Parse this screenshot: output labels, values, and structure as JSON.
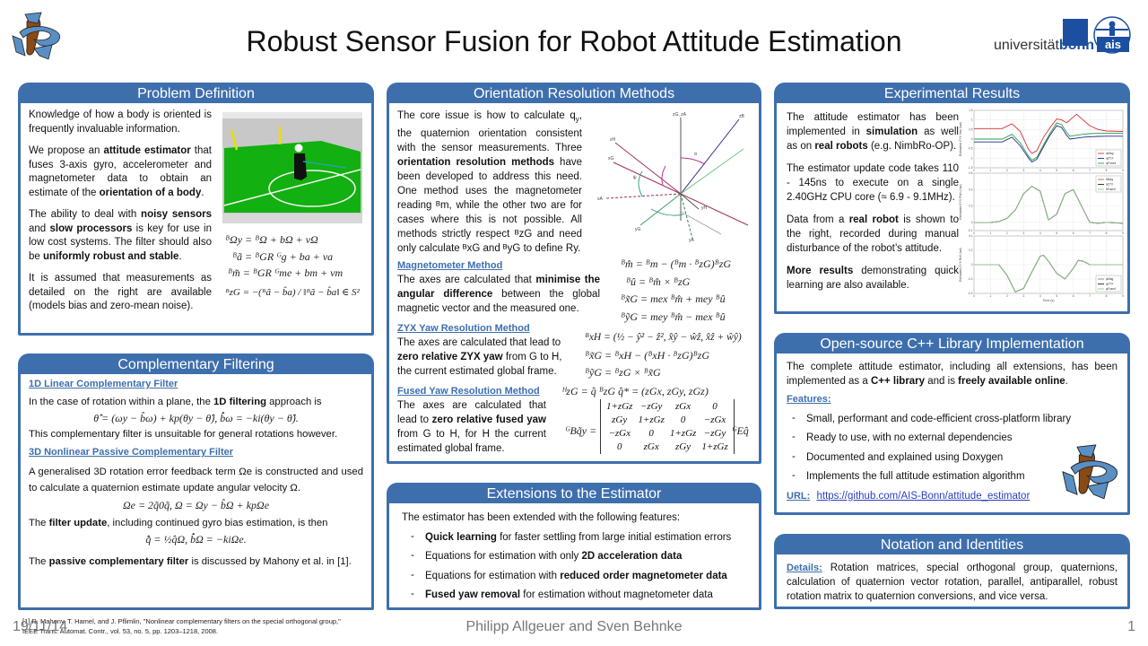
{
  "header": {
    "title": "Robust Sensor Fusion for Robot Attitude Estimation",
    "university_text_plain": "universität",
    "university_text_bold": "bonn",
    "ais_label": "ais"
  },
  "problem_definition": {
    "title": "Problem Definition",
    "p1": "Knowledge of how a body is oriented is frequently invaluable information.",
    "p2_a": "We propose an ",
    "p2_b": "attitude estimator",
    "p2_c": " that fuses 3-axis gyro, accelerometer and magnetometer data to obtain an estimate of the ",
    "p2_d": "orientation of a body",
    "p2_e": ".",
    "p3_a": "The ability to deal with ",
    "p3_b": "noisy sensors",
    "p3_c": " and ",
    "p3_d": "slow processors",
    "p3_e": " is key for use in low cost systems. The filter should also be ",
    "p3_f": "uniformly robust and stable",
    "p3_g": ".",
    "p4": "It is assumed that measurements as detailed on the right are available (models bias and zero-mean noise).",
    "equations": [
      "ᴮΩy = ᴮΩ + bΩ + vΩ",
      "ᴮã = ᴮGR ᴳg + ba + va",
      "ᴮm̃ = ᴮGR ᴳme + bm + vm",
      "ᴮzG = −(ᴮã − b̂a) / ‖ᴮã − b̂a‖ ∈ S²"
    ]
  },
  "complementary_filtering": {
    "title": "Complementary Filtering",
    "sub1": "1D Linear Complementary Filter",
    "p1_a": "In the case of rotation within a plane, the ",
    "p1_b": "1D filtering",
    "p1_c": " approach is",
    "eq1": "θ̂̇ = (ωy − b̂ω) + kp(θy − θ̂),    b̂̇ω = −ki(θy − θ̂).",
    "p2": "This complementary filter is unsuitable for general rotations however.",
    "sub2": "3D Nonlinear Passive Complementary Filter",
    "p3": "A generalised 3D rotation error feedback term Ωe is constructed and used to calculate a quaternion estimate update angular velocity Ω.",
    "eq2": "Ωe = 2q̃0q̃,    Ω = Ωy − b̂Ω + kpΩe",
    "p4_a": "The ",
    "p4_b": "filter update",
    "p4_c": ", including continued gyro bias estimation, is then",
    "eq3": "q̂̇ = ½q̂Ω,    b̂̇Ω = −kiΩe.",
    "p5_a": "The ",
    "p5_b": "passive complementary filter",
    "p5_c": " is discussed by Mahony et al. in [1].",
    "ref1": "[1] R. Mahony, T. Hamel, and J. Pflimlin, \"Nonlinear complementary filters on the special orthogonal group,\"",
    "ref2": "IEEE Trans. Automat. Contr., vol. 53, no. 5, pp. 1203–1218, 2008."
  },
  "orientation_methods": {
    "title": "Orientation Resolution Methods",
    "intro_a": "The core issue is how to calculate q",
    "intro_sub": "y",
    "intro_b": ", the quaternion orientation consistent with the sensor measurements. Three ",
    "intro_bold": "orientation resolution methods",
    "intro_c": " have been developed to address this need. One method uses the magnetometer reading ᴮm, while the other two are for cases where this is not possible. All methods strictly respect ᴮzG and need only calculate ᴮxG and ᴮyG to define Ry.",
    "diagram_labels": [
      "zG, zA",
      "zB",
      "xH",
      "xG",
      "xA",
      "yH",
      "yG",
      "yA",
      "α",
      "ψ"
    ],
    "mag_title": "Magnetometer Method",
    "mag_a": "The axes are calculated that ",
    "mag_bold": "minimise the angular difference",
    "mag_b": " between the global magnetic vector and the measured one.",
    "mag_eqs": [
      "ᴮm̂ = ᴮm − (ᴮm · ᴮzG)ᴮzG",
      "ᴮû = ᴮm̂ × ᴮzG",
      "ᴮx̃G = mex ᴮm̂ + mey ᴮû",
      "ᴮỹG = mey ᴮm̂ − mex ᴮû"
    ],
    "zyx_title": "ZYX Yaw Resolution Method",
    "zyx_a": "The axes are calculated that lead to ",
    "zyx_bold": "zero relative ZYX yaw",
    "zyx_b": " from G to H, the current estimated global frame.",
    "zyx_eqs": [
      "ᴮxH = (½ − ŷ² − ẑ², x̂ŷ − ŵẑ, x̂ẑ + ŵŷ)",
      "ᴮx̃G = ᴮxH − (ᴮxH · ᴮzG)ᴮzG",
      "ᴮỹG = ᴮzG × ᴮx̃G"
    ],
    "fused_title": "Fused Yaw Resolution Method",
    "fused_a": "The axes are calculated that lead to ",
    "fused_bold": "zero relative fused yaw",
    "fused_b": " from G to H, for H the current estimated global frame.",
    "fused_eq1": "ᴴzG = q̂ ᴮzG q̂* = (zGx, zGy, zGz)",
    "fused_lhs": "ᴳBq̃y =",
    "fused_rhs": "ᴳEq̂",
    "matrix": [
      [
        "1+zGz",
        "−zGy",
        "zGx",
        "0"
      ],
      [
        "zGy",
        "1+zGz",
        "0",
        "−zGx"
      ],
      [
        "−zGx",
        "0",
        "1+zGz",
        "−zGy"
      ],
      [
        "0",
        "zGx",
        "zGy",
        "1+zGz"
      ]
    ]
  },
  "extensions": {
    "title": "Extensions to the Estimator",
    "intro": "The estimator has been extended with the following features:",
    "items": [
      {
        "bold_pre": "Quick learning",
        "text": " for faster settling from large initial estimation errors",
        "bold_post": ""
      },
      {
        "bold_pre": "",
        "text": "Equations for estimation with only ",
        "bold_post": "2D acceleration data"
      },
      {
        "bold_pre": "",
        "text": "Equations for estimation with ",
        "bold_post": "reduced order magnetometer data"
      },
      {
        "bold_pre": "Fused yaw removal",
        "text": " for estimation without magnetometer data",
        "bold_post": ""
      }
    ]
  },
  "experimental": {
    "title": "Experimental Results",
    "p1_a": "The attitude estimator has been implemented in ",
    "p1_b": "simulation",
    "p1_c": " as well as on ",
    "p1_d": "real robots",
    "p1_e": " (e.g. NimbRo-OP).",
    "p2": "The estimator update code takes 110 - 145ns to execute on a single 2.40GHz CPU core (≈ 6.9 - 9.1MHz).",
    "p3_a": "Data from a ",
    "p3_b": "real robot",
    "p3_c": " is shown to the right, recorded during manual disturbance of the robot’s attitude.",
    "p4_a": "More results",
    "p4_b": " demonstrating quick learning are also available."
  },
  "chart_data": [
    {
      "type": "line",
      "title": "",
      "xlabel": "",
      "ylabel": "Estimated ZYX Yaw (rad)",
      "xlim": [
        0,
        9
      ],
      "ylim": [
        -1.5,
        1.5
      ],
      "x": [
        0,
        1,
        1.7,
        2.3,
        2.8,
        3.3,
        3.5,
        3.8,
        4.2,
        4.6,
        5.0,
        5.3,
        5.6,
        5.8,
        6.2,
        6.6,
        7.0,
        7.5,
        8.0,
        9.0
      ],
      "series": [
        {
          "name": "ψMag",
          "color": "#d93030",
          "values": [
            0.55,
            0.55,
            0.55,
            0.8,
            0.4,
            -0.55,
            -0.75,
            -0.6,
            0.1,
            0.6,
            1.05,
            1.0,
            0.85,
            1.0,
            1.3,
            1.0,
            0.7,
            0.5,
            0.42,
            0.4
          ]
        },
        {
          "name": "ψZYX",
          "color": "#1d2f8a",
          "values": [
            -0.15,
            -0.15,
            -0.15,
            0.1,
            -0.35,
            -1.0,
            -1.2,
            -1.05,
            -0.4,
            0.2,
            0.7,
            0.6,
            0.2,
            0.0,
            0.05,
            0.1,
            0.12,
            0.14,
            0.15,
            0.15
          ]
        },
        {
          "name": "ψFused",
          "color": "#2a9a50",
          "values": [
            0.0,
            0.0,
            0.0,
            0.25,
            -0.2,
            -0.9,
            -1.1,
            -0.95,
            -0.3,
            0.3,
            0.85,
            0.75,
            0.35,
            0.15,
            0.2,
            0.25,
            0.28,
            0.3,
            0.3,
            0.3
          ]
        }
      ],
      "yticks": [
        -1.5,
        -1,
        -0.5,
        0,
        0.5,
        1,
        1.5
      ],
      "xticks": [
        0,
        1,
        2,
        3,
        4,
        5,
        6,
        7,
        8,
        9
      ],
      "grid": true,
      "legend": "bottom-right"
    },
    {
      "type": "line",
      "title": "",
      "xlabel": "",
      "ylabel": "Estimated ZYX Pitch (rad)",
      "xlim": [
        0,
        9
      ],
      "ylim": [
        -0.1,
        0.6
      ],
      "x": [
        0,
        1,
        1.5,
        2,
        2.5,
        3,
        3.5,
        4,
        4.5,
        5,
        5.5,
        6,
        6.5,
        7,
        7.5,
        8,
        9
      ],
      "series": [
        {
          "name": "θMag",
          "color": "#9a7a4a",
          "values": [
            0,
            0,
            0.01,
            0.05,
            0.15,
            0.35,
            0.44,
            0.38,
            0.03,
            0.1,
            0.35,
            0.4,
            0.2,
            0.0,
            -0.01,
            0.0,
            -0.01
          ]
        },
        {
          "name": "θZYX",
          "color": "#222222",
          "values": [
            0,
            0,
            0.01,
            0.05,
            0.15,
            0.35,
            0.44,
            0.38,
            0.03,
            0.1,
            0.35,
            0.4,
            0.2,
            0.0,
            -0.01,
            0.0,
            -0.01
          ]
        },
        {
          "name": "θFused",
          "color": "#8ac48a",
          "values": [
            0,
            0,
            0.01,
            0.05,
            0.15,
            0.35,
            0.44,
            0.38,
            0.03,
            0.1,
            0.35,
            0.4,
            0.2,
            0.0,
            -0.01,
            0.0,
            -0.01
          ]
        }
      ],
      "yticks": [
        -0.1,
        0,
        0.2,
        0.4,
        0.6
      ],
      "xticks": [
        0,
        1,
        2,
        3,
        4,
        5,
        6,
        7,
        8,
        9
      ],
      "grid": true,
      "legend": "top-right"
    },
    {
      "type": "line",
      "title": "",
      "xlabel": "Time (s)",
      "ylabel": "Estimated ZYX Roll (rad)",
      "xlim": [
        0,
        9
      ],
      "ylim": [
        -0.4,
        0.4
      ],
      "x": [
        0,
        1,
        1.5,
        2,
        2.5,
        3,
        3.5,
        4,
        4.2,
        4.5,
        5,
        5.5,
        6,
        6.3,
        6.6,
        7,
        8,
        9
      ],
      "series": [
        {
          "name": "φMag",
          "color": "#9a7a4a",
          "values": [
            0,
            0,
            0,
            -0.15,
            -0.38,
            -0.33,
            -0.1,
            0.12,
            0.13,
            0.05,
            -0.12,
            -0.2,
            -0.05,
            0.06,
            0.05,
            0.0,
            0.0,
            0.0
          ]
        },
        {
          "name": "φZYX",
          "color": "#222222",
          "values": [
            0,
            0,
            0,
            -0.15,
            -0.38,
            -0.33,
            -0.1,
            0.12,
            0.13,
            0.05,
            -0.12,
            -0.2,
            -0.05,
            0.06,
            0.05,
            0.0,
            0.0,
            0.0
          ]
        },
        {
          "name": "φFused",
          "color": "#8ac48a",
          "values": [
            0,
            0,
            0,
            -0.15,
            -0.38,
            -0.33,
            -0.1,
            0.12,
            0.13,
            0.05,
            -0.12,
            -0.2,
            -0.05,
            0.06,
            0.05,
            0.0,
            0.0,
            0.0
          ]
        }
      ],
      "yticks": [
        -0.4,
        -0.2,
        0,
        0.2,
        0.4
      ],
      "xticks": [
        0,
        1,
        2,
        3,
        4,
        5,
        6,
        7,
        8,
        9
      ],
      "grid": true,
      "legend": "bottom-right"
    }
  ],
  "library": {
    "title": "Open-source C++ Library Implementation",
    "p1_a": "The complete attitude estimator, including all extensions, has been implemented as a ",
    "p1_b": "C++ library",
    "p1_c": " and is ",
    "p1_d": "freely available online",
    "p1_e": ".",
    "features_label": "Features:",
    "features": [
      "Small, performant and code-efficient cross-platform library",
      "Ready to use, with no external dependencies",
      "Documented and explained using Doxygen",
      "Implements the full attitude estimation algorithm"
    ],
    "url_label": "URL:",
    "url": "https://github.com/AIS-Bonn/attitude_estimator"
  },
  "notation": {
    "title": "Notation and Identities",
    "details_label": "Details:",
    "text": " Rotation matrices, special orthogonal group, quaternions, calculation of quaternion vector rotation, parallel, antiparallel, robust rotation matrix to quaternion conversions, and vice versa."
  },
  "footer": {
    "date": "19/11/14",
    "authors": "Philipp Allgeuer and Sven Behnke",
    "page": "1"
  },
  "colors": {
    "panel_header": "#3e6fad",
    "link": "#2c3fbf",
    "subheading": "#3e6fad"
  }
}
